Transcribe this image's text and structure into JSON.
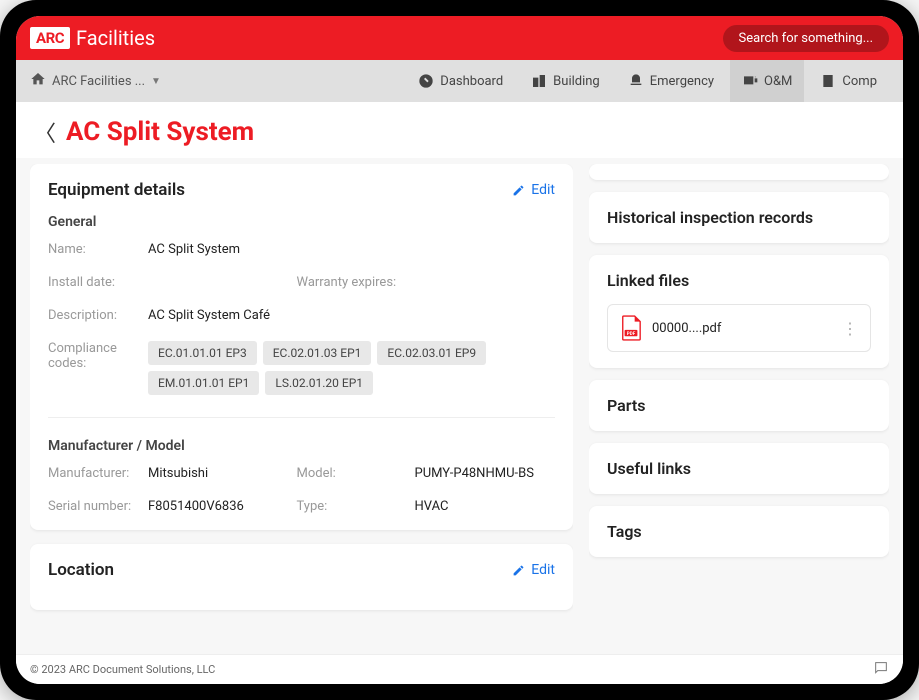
{
  "header": {
    "logo_badge": "ARC",
    "logo_text": "Facilities",
    "search_placeholder": "Search for something..."
  },
  "breadcrumb": {
    "label": "ARC Facilities ..."
  },
  "nav": {
    "dashboard": "Dashboard",
    "building": "Building",
    "emergency": "Emergency",
    "om": "O&M",
    "compliance": "Comp"
  },
  "page": {
    "title": "AC Split System"
  },
  "equipment": {
    "card_title": "Equipment details",
    "edit_label": "Edit",
    "general_label": "General",
    "name_label": "Name:",
    "name_value": "AC Split System",
    "install_label": "Install date:",
    "install_value": "",
    "warranty_label": "Warranty expires:",
    "warranty_value": "",
    "description_label": "Description:",
    "description_value": "AC Split System Café",
    "compliance_label": "Compliance codes:",
    "codes": [
      "EC.01.01.01 EP3",
      "EC.02.01.03 EP1",
      "EC.02.03.01 EP9",
      "EM.01.01.01 EP1",
      "LS.02.01.20 EP1"
    ],
    "man_label": "Manufacturer / Model",
    "manufacturer_label": "Manufacturer:",
    "manufacturer_value": "Mitsubishi",
    "model_label": "Model:",
    "model_value": "PUMY-P48NHMU-BS",
    "serial_label": "Serial number:",
    "serial_value": "F8051400V6836",
    "type_label": "Type:",
    "type_value": "HVAC"
  },
  "location": {
    "card_title": "Location",
    "edit_label": "Edit"
  },
  "sidebar": {
    "historical": "Historical inspection records",
    "linked_files": "Linked files",
    "file_name": "00000....pdf",
    "parts": "Parts",
    "useful_links": "Useful links",
    "tags": "Tags"
  },
  "footer": {
    "copyright": "© 2023 ARC Document Solutions, LLC"
  }
}
